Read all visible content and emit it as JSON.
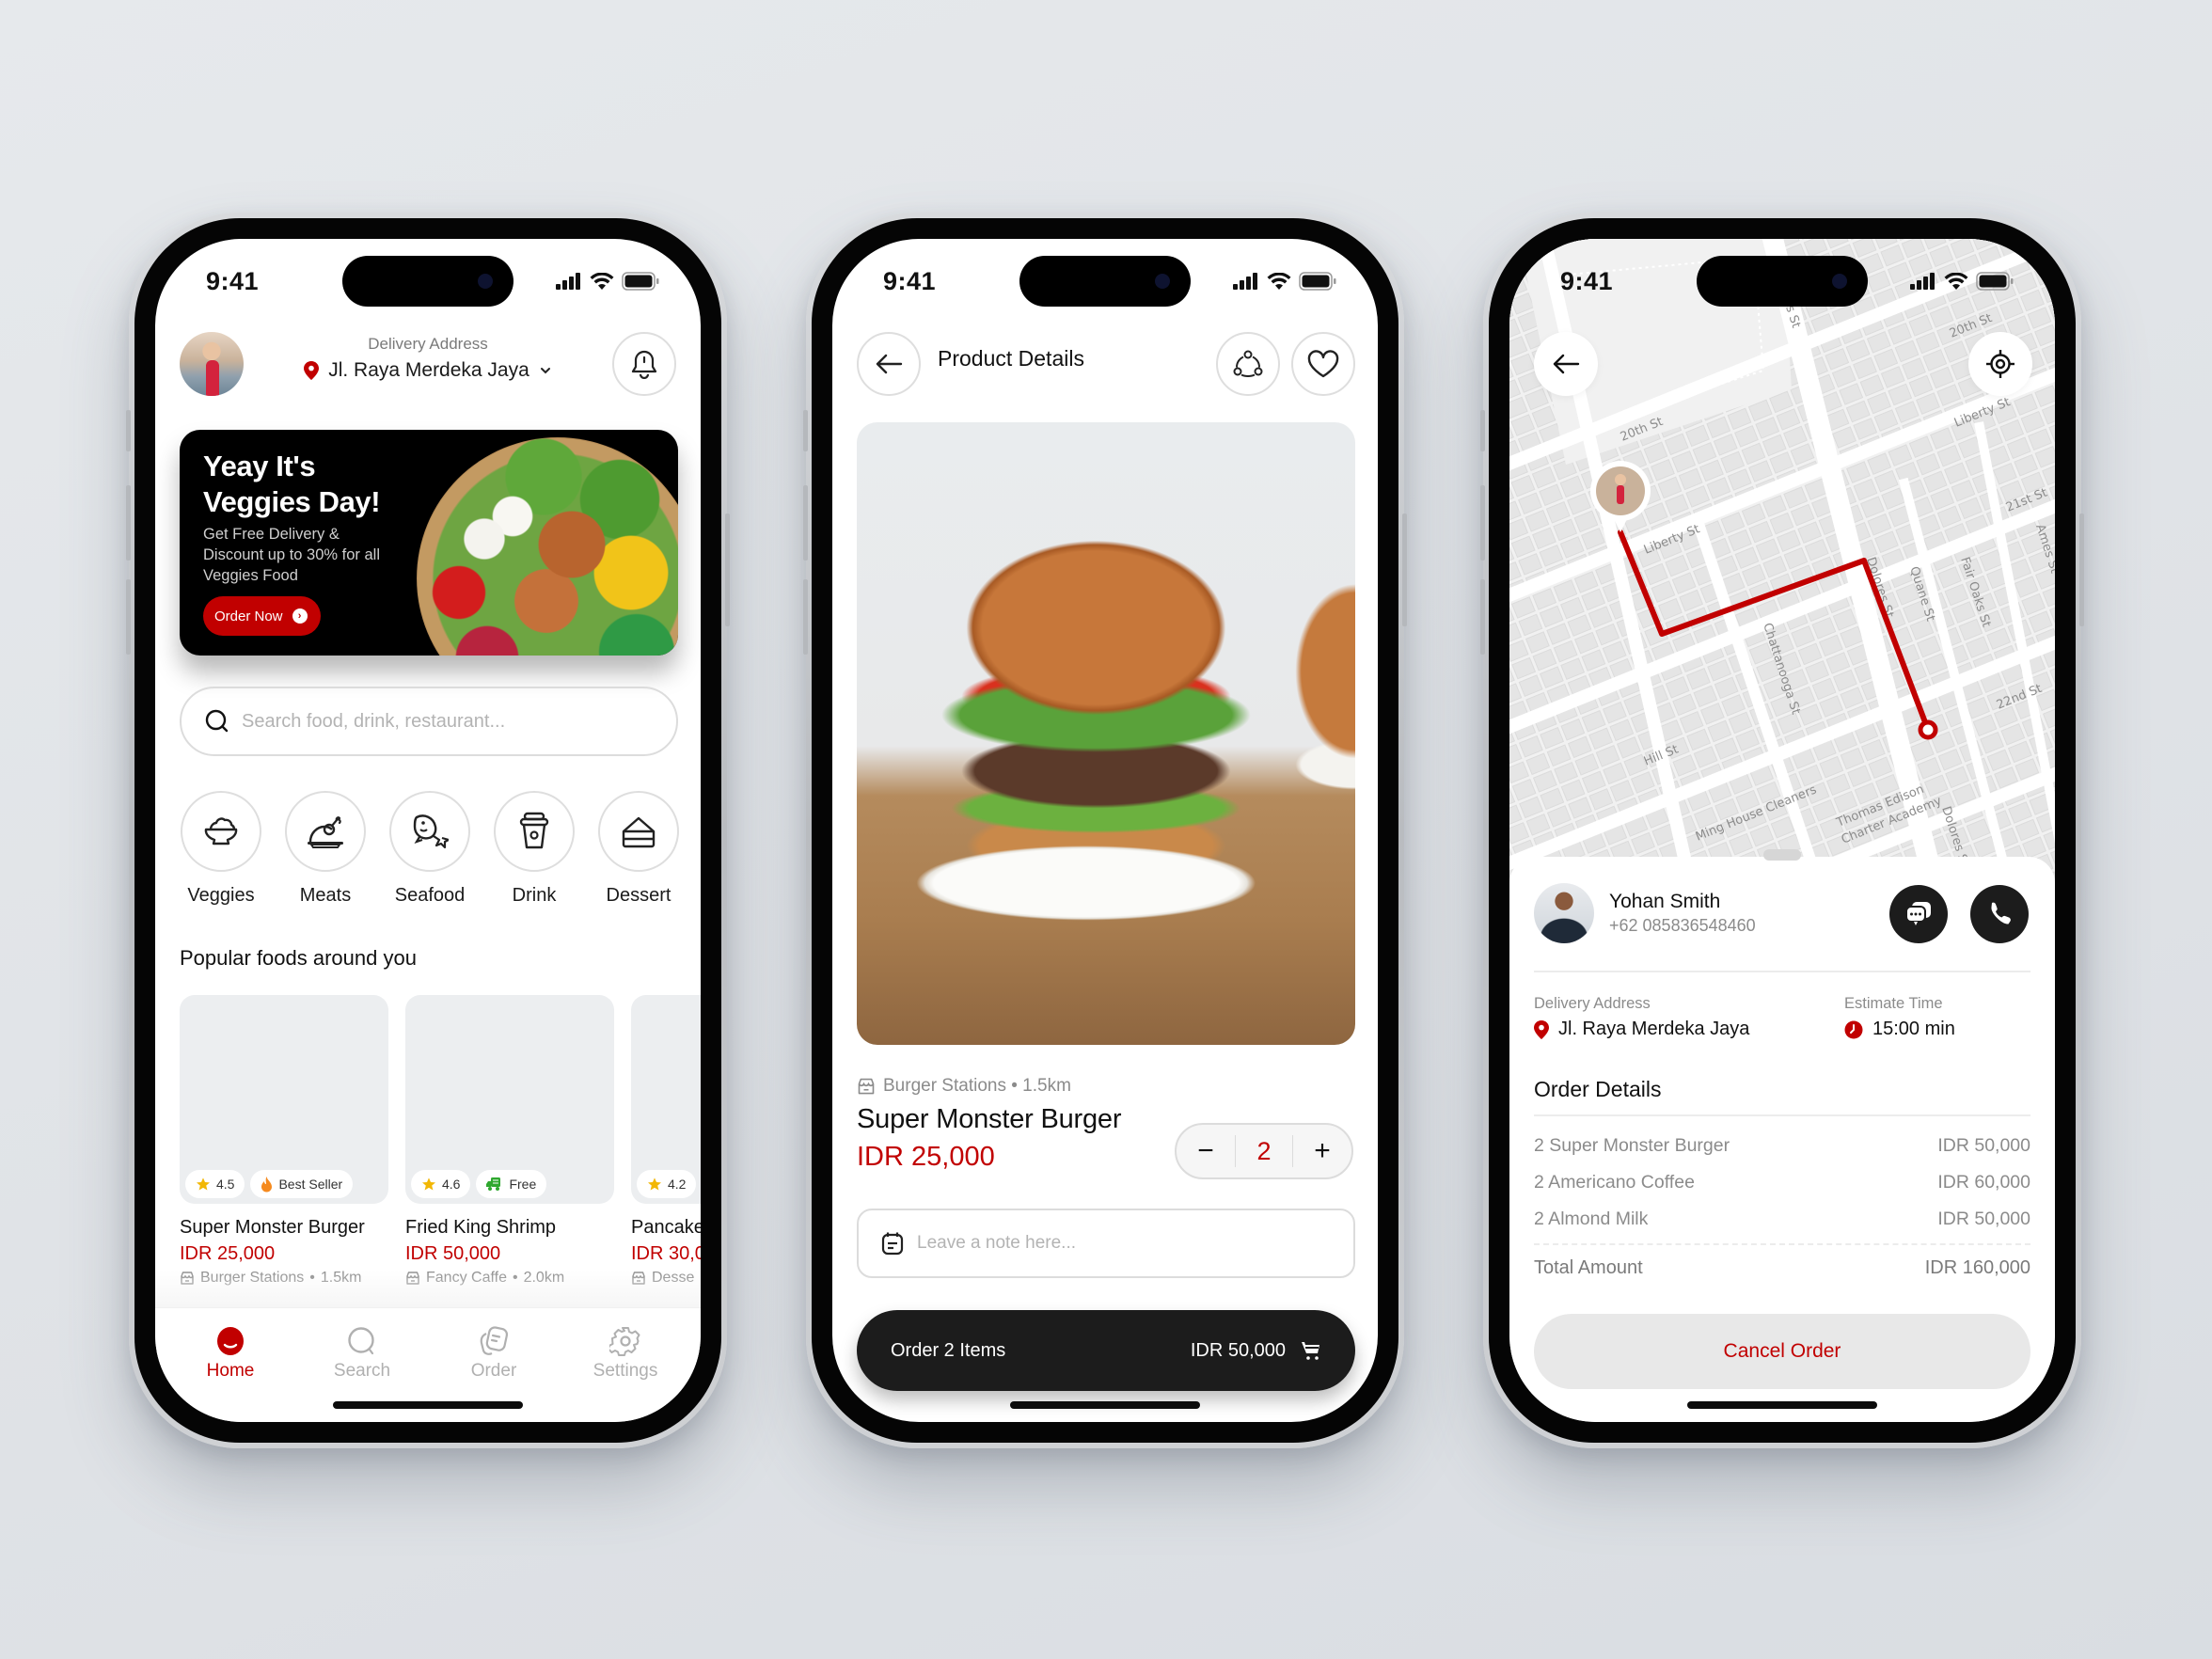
{
  "colors": {
    "accent": "#c10000",
    "dark": "#1c1c1c",
    "muted": "#8b8b8b",
    "background": "#e3e6e9"
  },
  "status_bar": {
    "time": "9:41",
    "icons": [
      "signal-icon",
      "wifi-icon",
      "battery-icon"
    ]
  },
  "home": {
    "delivery_label": "Delivery Address",
    "address": "Jl. Raya Merdeka Jaya",
    "banner": {
      "title": "Yeay It's Veggies Day!",
      "subtitle": "Get Free Delivery & Discount up to 30% for all Veggies Food",
      "cta": "Order Now"
    },
    "search_placeholder": "Search food, drink, restaurant...",
    "categories": [
      {
        "label": "Veggies",
        "icon": "salad-bowl-icon"
      },
      {
        "label": "Meats",
        "icon": "roast-chicken-icon"
      },
      {
        "label": "Seafood",
        "icon": "fish-icon"
      },
      {
        "label": "Drink",
        "icon": "cup-icon"
      },
      {
        "label": "Dessert",
        "icon": "cake-slice-icon"
      }
    ],
    "section_title": "Popular foods around you",
    "foods": [
      {
        "name": "Super Monster Burger",
        "price": "IDR 25,000",
        "store": "Burger Stations",
        "distance": "1.5km",
        "rating": "4.5",
        "tag": "Best Seller",
        "tag_icon": "fire-icon"
      },
      {
        "name": "Fried King Shrimp",
        "price": "IDR 50,000",
        "store": "Fancy Caffe",
        "distance": "2.0km",
        "rating": "4.6",
        "tag": "Free",
        "tag_icon": "delivery-truck-icon"
      },
      {
        "name": "Pancake",
        "price": "IDR 30,0",
        "store": "Desse",
        "distance": "",
        "rating": "4.2",
        "tag": "",
        "tag_icon": ""
      }
    ],
    "tabs": [
      {
        "label": "Home",
        "icon": "home-icon",
        "active": true
      },
      {
        "label": "Search",
        "icon": "search-icon",
        "active": false
      },
      {
        "label": "Order",
        "icon": "order-icon",
        "active": false
      },
      {
        "label": "Settings",
        "icon": "gear-icon",
        "active": false
      }
    ]
  },
  "product": {
    "title": "Product Details",
    "store": "Burger Stations",
    "distance": "1.5km",
    "store_line": "Burger Stations • 1.5km",
    "name": "Super Monster Burger",
    "price": "IDR 25,000",
    "quantity": "2",
    "minus": "−",
    "plus": "+",
    "note_placeholder": "Leave a note here...",
    "order_label": "Order 2 Items",
    "order_total": "IDR 50,000"
  },
  "tracking": {
    "map_labels": [
      "20th St",
      "20th St",
      "Liberty St",
      "Liberty St",
      "21st St",
      "22nd St",
      "Hill St",
      "Dolores St",
      "Dolores St",
      "Chattanooga St",
      "Quane St",
      "Fair Oaks St",
      "Ames St",
      "Ming House Cleaners",
      "Thomas Edison Charter Academy",
      "res St"
    ],
    "driver": {
      "name": "Yohan Smith",
      "phone": "+62 085836548460"
    },
    "delivery_label": "Delivery Address",
    "delivery_address": "Jl. Raya Merdeka Jaya",
    "eta_label": "Estimate Time",
    "eta": "15:00 min",
    "order_details_title": "Order Details",
    "items": [
      {
        "name": "2 Super Monster Burger",
        "price": "IDR 50,000"
      },
      {
        "name": "2 Americano Coffee",
        "price": "IDR 60,000"
      },
      {
        "name": "2 Almond Milk",
        "price": "IDR 50,000"
      }
    ],
    "total_label": "Total Amount",
    "total": "IDR 160,000",
    "cancel_label": "Cancel Order"
  }
}
